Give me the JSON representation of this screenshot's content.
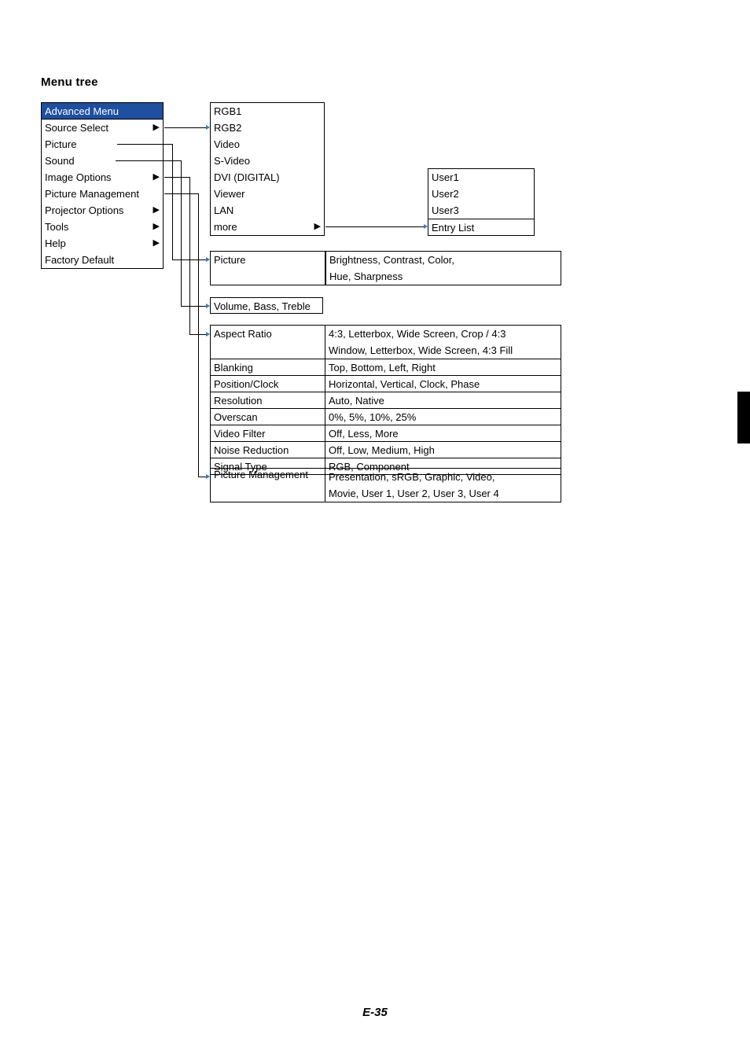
{
  "title": "Menu tree",
  "page_number": "E-35",
  "advanced_menu": {
    "title": "Advanced Menu",
    "items": [
      {
        "label": "Source Select",
        "arrow": true
      },
      {
        "label": "Picture",
        "arrow": false
      },
      {
        "label": "Sound",
        "arrow": false
      },
      {
        "label": "Image Options",
        "arrow": true
      },
      {
        "label": "Picture Management",
        "arrow": false
      },
      {
        "label": "Projector Options",
        "arrow": true
      },
      {
        "label": "Tools",
        "arrow": true
      },
      {
        "label": "Help",
        "arrow": true
      },
      {
        "label": "Factory Default",
        "arrow": false
      }
    ]
  },
  "source_list": {
    "items": [
      "RGB1",
      "RGB2",
      "Video",
      "S-Video",
      "DVI (DIGITAL)",
      "Viewer",
      "LAN"
    ],
    "more": "more"
  },
  "more_list": [
    "User1",
    "User2",
    "User3",
    "Entry List"
  ],
  "picture": {
    "label": "Picture",
    "values": [
      "Brightness, Contrast, Color,",
      "Hue, Sharpness"
    ]
  },
  "sound": "Volume, Bass, Treble",
  "image_options": [
    {
      "name": "Aspect Ratio",
      "value": [
        "4:3, Letterbox, Wide Screen, Crop / 4:3",
        "Window, Letterbox, Wide Screen, 4:3 Fill"
      ]
    },
    {
      "name": "Blanking",
      "value": [
        "Top, Bottom, Left, Right"
      ]
    },
    {
      "name": "Position/Clock",
      "value": [
        "Horizontal, Vertical, Clock, Phase"
      ]
    },
    {
      "name": "Resolution",
      "value": [
        "Auto, Native"
      ]
    },
    {
      "name": "Overscan",
      "value": [
        "0%, 5%, 10%, 25%"
      ]
    },
    {
      "name": "Video Filter",
      "value": [
        "Off, Less, More"
      ]
    },
    {
      "name": "Noise Reduction",
      "value": [
        "Off, Low, Medium, High"
      ]
    },
    {
      "name": "Signal Type",
      "value": [
        "RGB, Component"
      ]
    }
  ],
  "picture_management": {
    "name": "Picture Management",
    "value": [
      "Presentation, sRGB, Graphic, Video,",
      "Movie, User 1, User 2, User 3, User 4"
    ]
  }
}
